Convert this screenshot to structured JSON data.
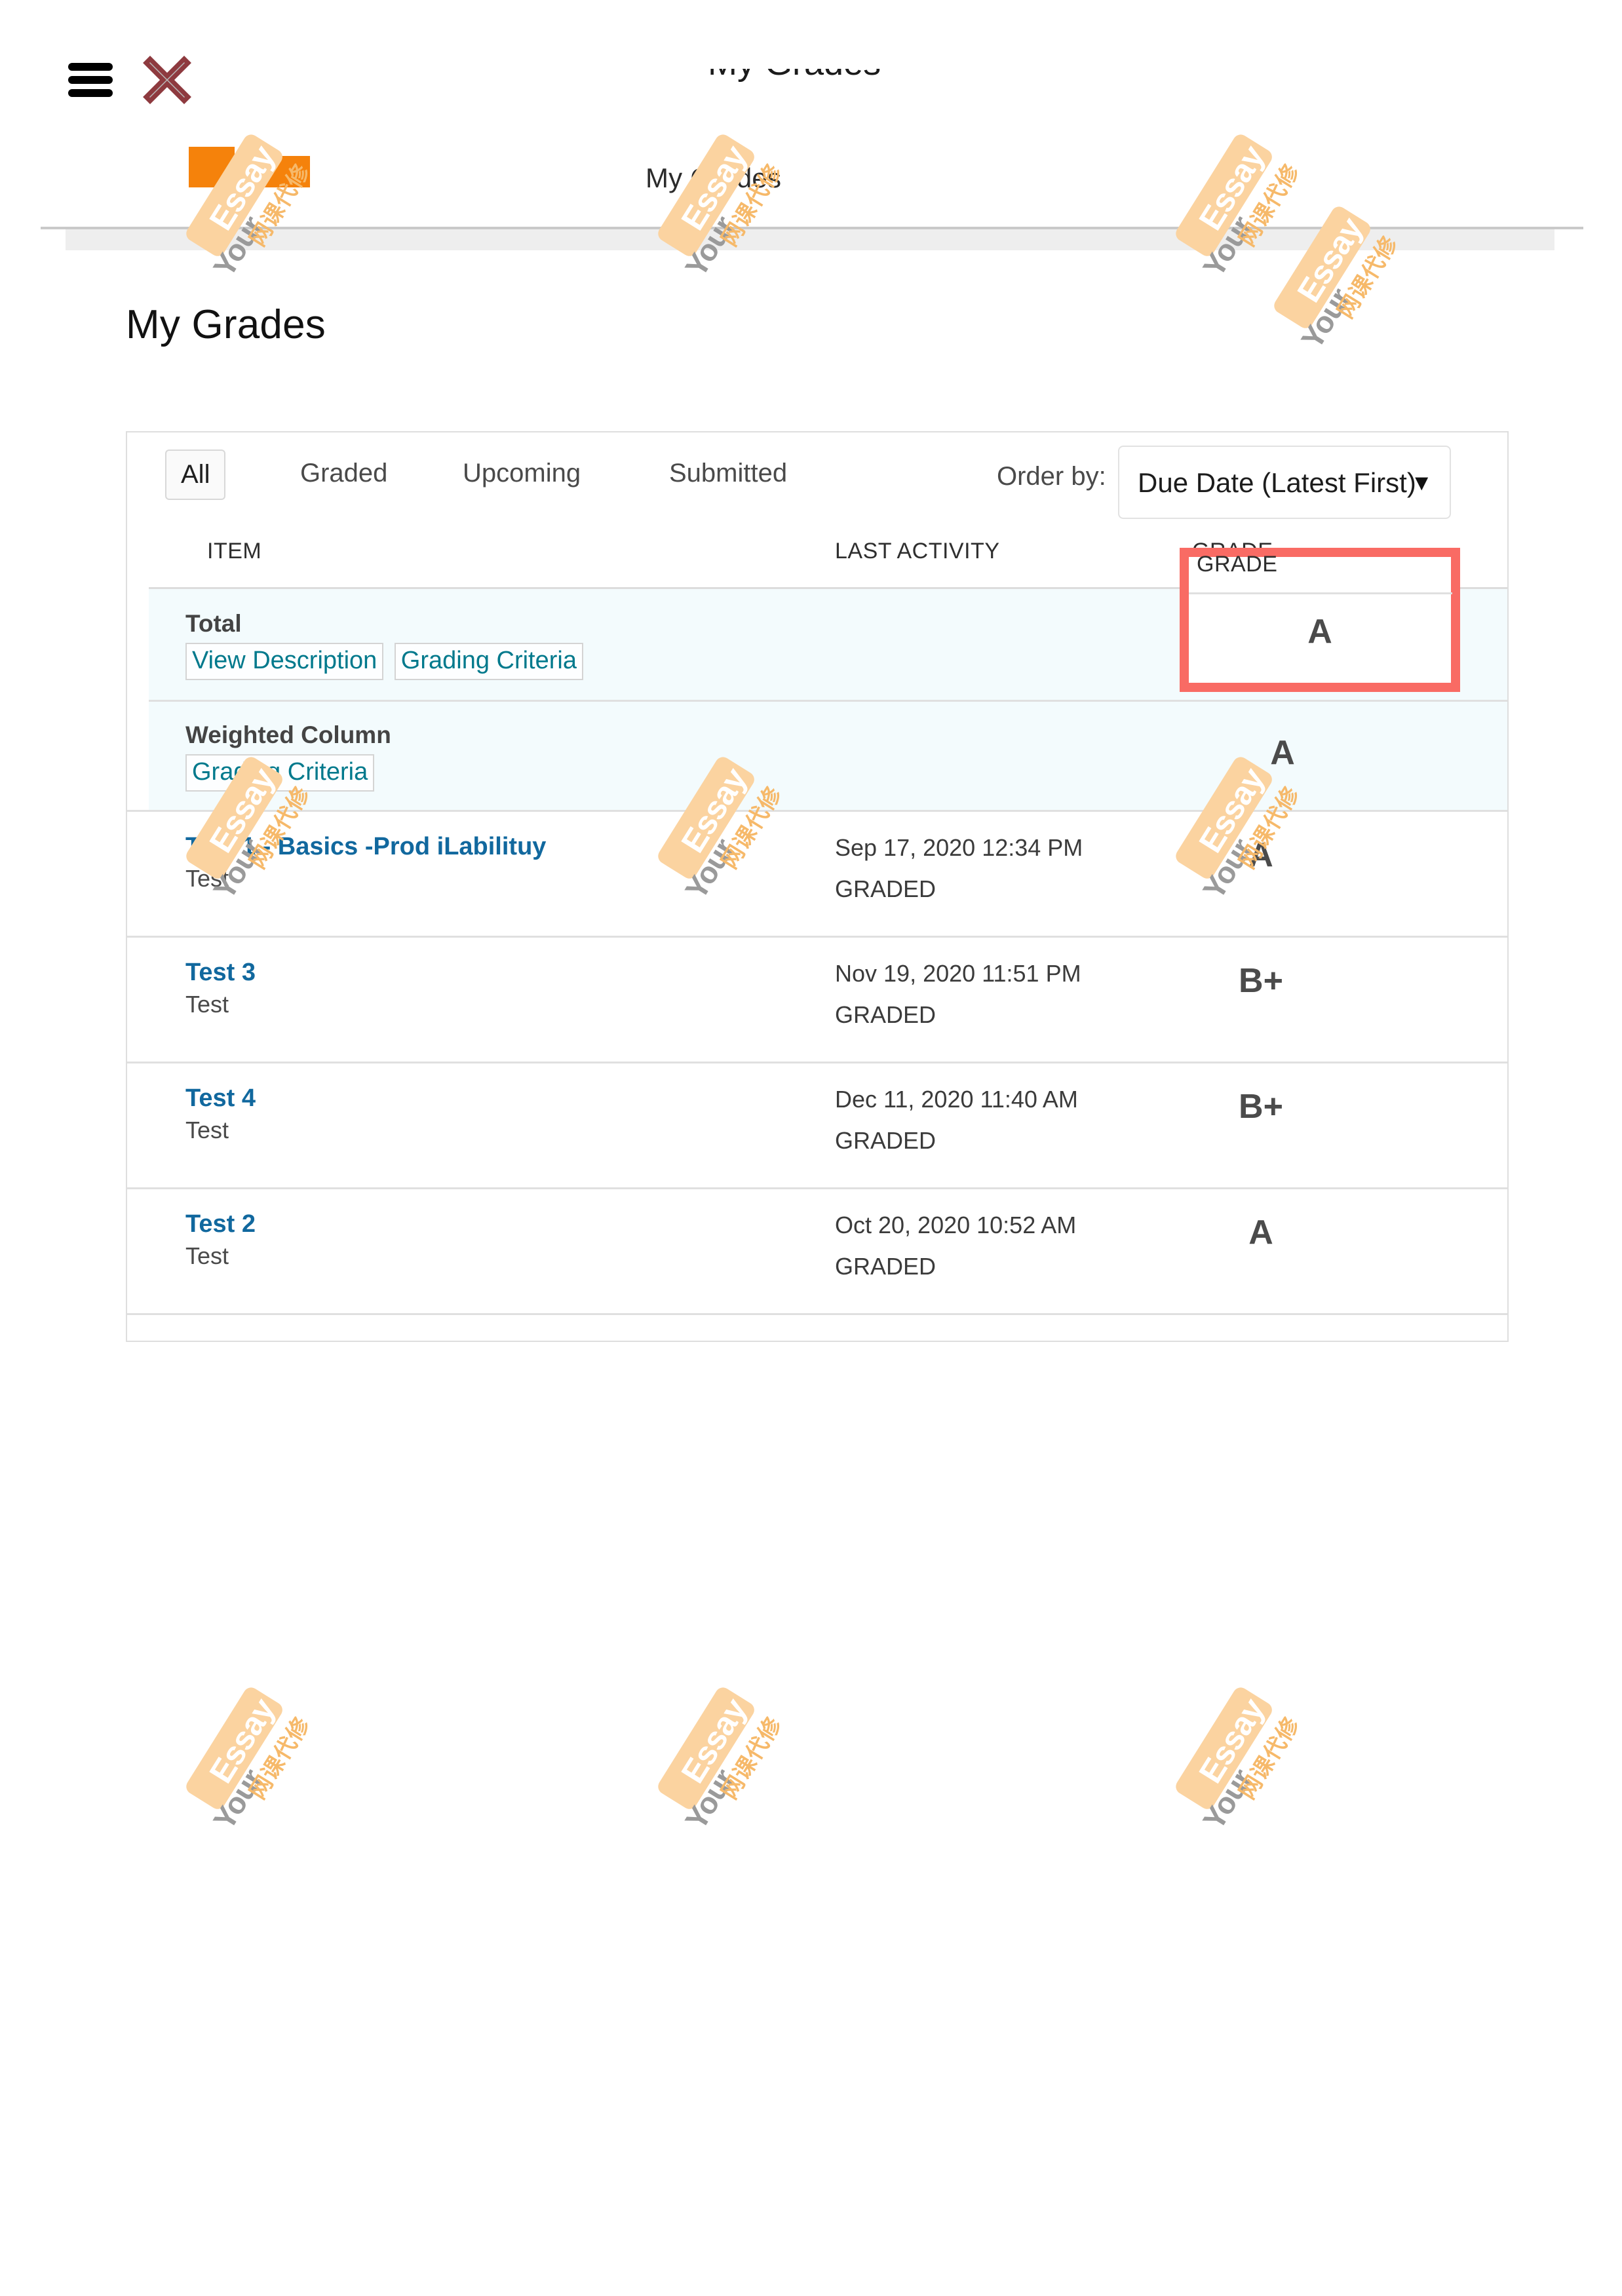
{
  "topbar": {
    "menu_icon": "hamburger-menu-icon",
    "close_icon": "close-x-icon",
    "clipped_text": "My Grades",
    "redaction_label": "",
    "nav_tab_label": "My Grades"
  },
  "page": {
    "title": "My Grades"
  },
  "filters": {
    "tabs": [
      {
        "label": "All",
        "selected": true
      },
      {
        "label": "Graded",
        "selected": false
      },
      {
        "label": "Upcoming",
        "selected": false
      },
      {
        "label": "Submitted",
        "selected": false
      }
    ],
    "order_by_label": "Order by:",
    "order_by_value": "Due Date (Latest First)",
    "order_by_caret": "▼"
  },
  "table": {
    "columns": {
      "item": "ITEM",
      "last_activity": "LAST ACTIVITY",
      "grade": "GRADE"
    },
    "summary_rows": [
      {
        "title": "Total",
        "links": [
          "View Description",
          "Grading Criteria"
        ],
        "last_activity": "",
        "grade": "A"
      },
      {
        "title": "Weighted Column",
        "links": [
          "Grading Criteria"
        ],
        "last_activity": "",
        "grade": "A"
      }
    ],
    "item_rows": [
      {
        "name": "Test 1 - Basics -Prod iLabilituy",
        "type": "Test",
        "date": "Sep 17, 2020 12:34 PM",
        "status": "GRADED",
        "grade": "A"
      },
      {
        "name": "Test 3",
        "type": "Test",
        "date": "Nov 19, 2020 11:51 PM",
        "status": "GRADED",
        "grade": "B+"
      },
      {
        "name": "Test 4",
        "type": "Test",
        "date": "Dec 11, 2020 11:40 AM",
        "status": "GRADED",
        "grade": "B+"
      },
      {
        "name": "Test 2",
        "type": "Test",
        "date": "Oct 20, 2020 10:52 AM",
        "status": "GRADED",
        "grade": "A"
      }
    ]
  },
  "annotation": {
    "highlight_color": "#F96B64",
    "highlighted_column": "GRADE",
    "highlighted_value": "A"
  },
  "watermark": {
    "word_1": "Your",
    "word_2": "Essay",
    "word_cn": "网课代修",
    "tag_color": "#FBD3A0"
  },
  "colors": {
    "link_teal": "#00798C",
    "link_blue": "#11689E",
    "summary_row_bg": "#F3FBFD",
    "redaction_orange": "#F5820B",
    "close_icon_outline": "#8E3A3F"
  }
}
